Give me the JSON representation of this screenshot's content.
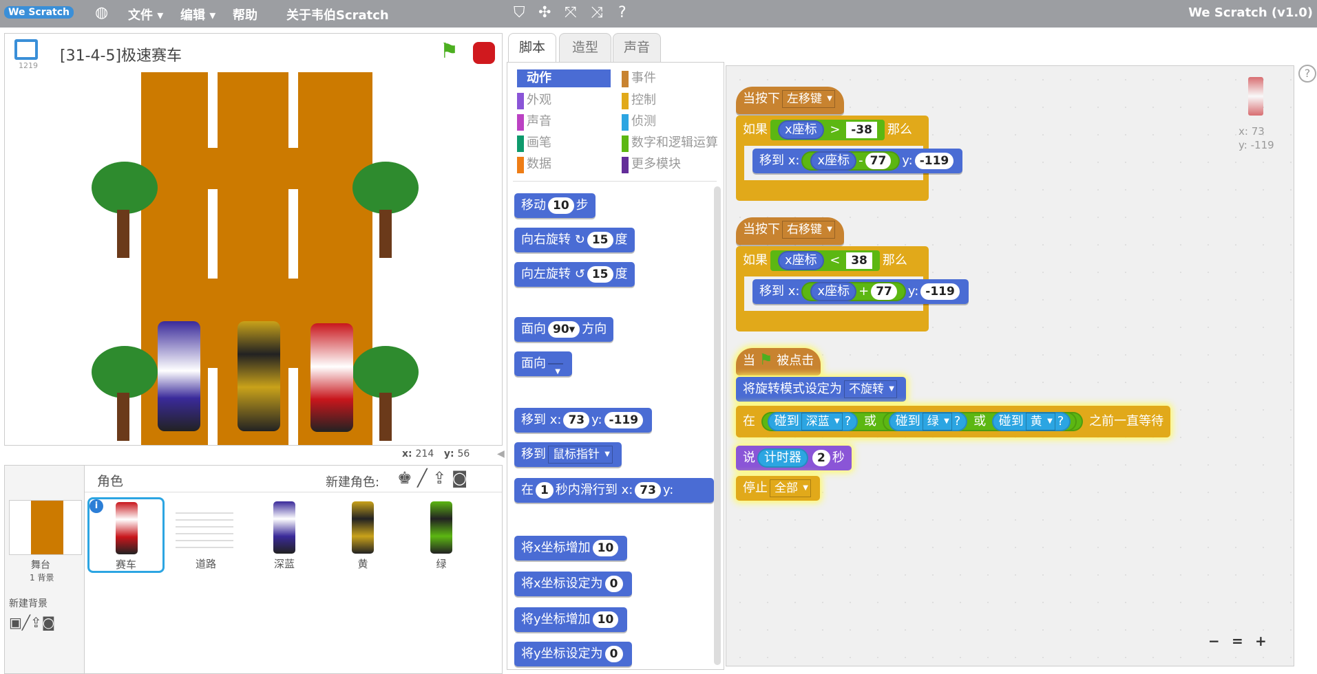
{
  "menubar": {
    "logo": "We Scratch",
    "globe": "globe-icon",
    "file": "文件",
    "edit": "编辑",
    "help": "帮助",
    "about": "关于韦伯Scratch",
    "title": "We Scratch (v1.0)"
  },
  "stage": {
    "project_name": "[31-4-5]极速赛车",
    "version_small": "1219",
    "x_label": "x:",
    "x_value": "214",
    "y_label": "y:",
    "y_value": "56"
  },
  "sprites_panel": {
    "title": "角色",
    "new_sprite": "新建角色:",
    "stage_label": "舞台",
    "stage_backdrops": "1 背景",
    "new_backdrop": "新建背景",
    "items": [
      {
        "label": "赛车"
      },
      {
        "label": "道路"
      },
      {
        "label": "深蓝"
      },
      {
        "label": "黄"
      },
      {
        "label": "绿"
      }
    ]
  },
  "tabs": [
    "脚本",
    "造型",
    "声音"
  ],
  "categories": {
    "motion": "动作",
    "looks": "外观",
    "sound": "声音",
    "pen": "画笔",
    "data": "数据",
    "events": "事件",
    "control": "控制",
    "sensing": "侦测",
    "operators": "数字和逻辑运算",
    "more": "更多模块"
  },
  "palette": {
    "move": "移动",
    "move_steps": "10",
    "steps": "步",
    "turn_right": "向右旋转",
    "turn_right_deg": "15",
    "degrees": "度",
    "turn_left": "向左旋转",
    "turn_left_deg": "15",
    "point_dir": "面向",
    "point_dir_val": "90",
    "direction": "方向",
    "point_towards": "面向",
    "goto_xy": "移到 x:",
    "goto_x": "73",
    "y": "y:",
    "goto_y": "-119",
    "goto": "移到",
    "goto_target": "鼠标指针",
    "glide_in": "在",
    "glide_secs": "1",
    "glide_text": "秒内滑行到 x:",
    "glide_x": "73",
    "glide_y": "y:",
    "change_x": "将x坐标增加",
    "change_x_val": "10",
    "set_x": "将x坐标设定为",
    "set_x_val": "0",
    "change_y": "将y坐标增加",
    "change_y_val": "10",
    "set_y": "将y坐标设定为",
    "set_y_val": "0"
  },
  "scripts": {
    "s1": {
      "when_key": "当按下",
      "key": "左移键",
      "if": "如果",
      "xpos": "x座标",
      "op": ">",
      "val": "-38",
      "then": "那么",
      "goto": "移到 x:",
      "minus": "-",
      "num": "77",
      "y": "y:",
      "yval": "-119"
    },
    "s2": {
      "when_key": "当按下",
      "key": "右移键",
      "if": "如果",
      "xpos": "x座标",
      "op": "<",
      "val": "38",
      "then": "那么",
      "goto": "移到 x:",
      "plus": "+",
      "num": "77",
      "y": "y:",
      "yval": "-119"
    },
    "s3": {
      "when": "当",
      "clicked": "被点击",
      "rotation": "将旋转模式设定为",
      "rotation_val": "不旋转",
      "wait_in": "在",
      "touch": "碰到",
      "c1": "深蓝",
      "c2": "绿",
      "c3": "黄",
      "q": "?",
      "or": "或",
      "until": "之前一直等待",
      "say": "说",
      "timer": "计时器",
      "secs_val": "2",
      "secs": "秒",
      "stop": "停止",
      "stop_val": "全部"
    },
    "coords_x": "x: 73",
    "coords_y": "y: -119"
  }
}
